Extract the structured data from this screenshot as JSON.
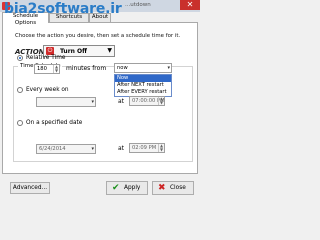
{
  "window": {
    "watermark": "bia2software.ir",
    "title": "...utdown",
    "close_label": "✕"
  },
  "tabs": [
    {
      "label": "Schedule Options"
    },
    {
      "label": "Shortcuts"
    },
    {
      "label": "About"
    }
  ],
  "description": "Choose the action you desire, then set a schedule time for it.",
  "action": {
    "label": "ACTION",
    "value": "Turn Off",
    "arrow": "▼"
  },
  "schedule": {
    "group_label": "Time Schedule",
    "relative": {
      "label": "Relative Time",
      "minutes_value": "180",
      "minutes_label": "minutes from",
      "from_value": "now",
      "from_options": [
        "Now",
        "After NEXT restart",
        "After EVERY restart"
      ]
    },
    "weekly": {
      "label": "Every week on",
      "at_label": "at",
      "time_value": "07:00:00 PM"
    },
    "date": {
      "label": "On a specified date",
      "date_value": "6/24/2014",
      "at_label": "at",
      "time_value": "02:09 PM"
    }
  },
  "buttons": {
    "advanced": "Advanced...",
    "apply": "Apply",
    "close": "Close"
  }
}
